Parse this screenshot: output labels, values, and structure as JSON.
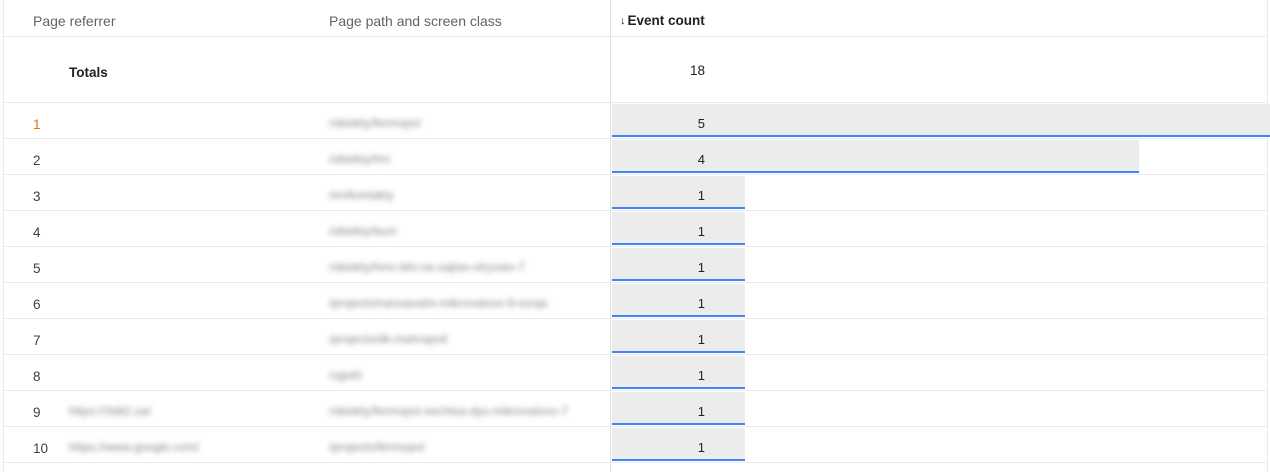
{
  "header": {
    "referrer": "Page referrer",
    "path": "Page path and screen class",
    "metric": "Event count",
    "sort_icon": "arrow-down-icon"
  },
  "totals": {
    "label": "Totals",
    "value": "18"
  },
  "colors": {
    "bar_fill": "#ececec",
    "bar_underline": "#4285f4",
    "first_rank": "#e37400"
  },
  "max_value": 5,
  "rows": [
    {
      "rank": "1",
      "referrer": "",
      "path": "/obiekty/fermopol",
      "value": 5
    },
    {
      "rank": "2",
      "referrer": "",
      "path": "/obiekty/hm",
      "value": 4
    },
    {
      "rank": "3",
      "referrer": "",
      "path": "/en/kontakty",
      "value": 1
    },
    {
      "rank": "4",
      "referrer": "",
      "path": "/obiekty/bum",
      "value": 1
    },
    {
      "rank": "5",
      "referrer": "",
      "path": "/obiekty/hmc-bhi-na-sajtse-otryvaiv-7",
      "value": 1
    },
    {
      "rank": "6",
      "referrer": "",
      "path": "/projects/nanoavaloi-mikrovalovo-9-sonja",
      "value": 1
    },
    {
      "rank": "7",
      "referrer": "",
      "path": "/projects/dk-mahrapoil",
      "value": 1
    },
    {
      "rank": "8",
      "referrer": "",
      "path": "/ugotri",
      "value": 1
    },
    {
      "rank": "9",
      "referrer": "https://3dit2.ua/",
      "path": "/obiekty/fermopol-sechtsa-dyu-mikrovalovo-7",
      "value": 1
    },
    {
      "rank": "10",
      "referrer": "https://www.google.com/",
      "path": "/projects/fermopol",
      "value": 1
    }
  ]
}
